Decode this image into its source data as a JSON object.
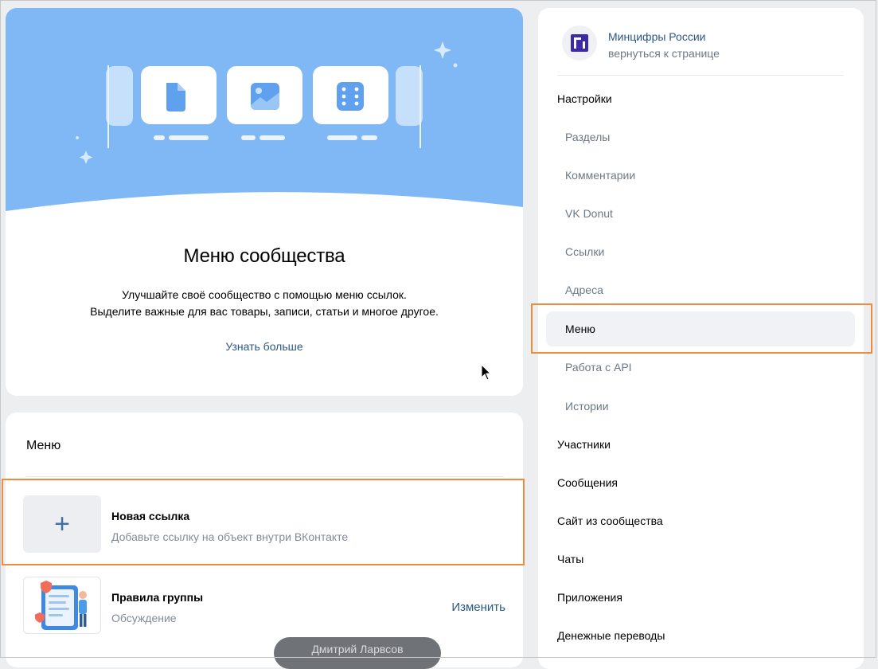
{
  "promo": {
    "title": "Меню сообщества",
    "desc_line1": "Улучшайте своё сообщество с помощью меню ссылок.",
    "desc_line2": "Выделите важные для вас товары, записи, статьи и многое другое.",
    "link": "Узнать больше",
    "hero_icons": [
      "document-icon",
      "image-icon",
      "dice-icon"
    ]
  },
  "menu": {
    "heading": "Меню",
    "items": [
      {
        "title": "Новая ссылка",
        "subtitle": "Добавьте ссылку на объект внутри ВКонтакте",
        "icon": "plus-icon"
      },
      {
        "title": "Правила группы",
        "subtitle": "Обсуждение",
        "action": "Изменить"
      }
    ]
  },
  "toast": {
    "text": "Дмитрий Ларвсов"
  },
  "community": {
    "name": "Минцифры России",
    "back": "вернуться к странице"
  },
  "settings_nav": [
    {
      "label": "Настройки",
      "kind": "section"
    },
    {
      "label": "Разделы",
      "kind": "sub"
    },
    {
      "label": "Комментарии",
      "kind": "sub"
    },
    {
      "label": "VK Donut",
      "kind": "sub"
    },
    {
      "label": "Ссылки",
      "kind": "sub"
    },
    {
      "label": "Адреса",
      "kind": "sub"
    },
    {
      "label": "Меню",
      "kind": "sub",
      "active": true
    },
    {
      "label": "Работа с API",
      "kind": "sub"
    },
    {
      "label": "Истории",
      "kind": "sub"
    },
    {
      "label": "Участники",
      "kind": "section"
    },
    {
      "label": "Сообщения",
      "kind": "section"
    },
    {
      "label": "Сайт из сообщества",
      "kind": "section"
    },
    {
      "label": "Чаты",
      "kind": "section"
    },
    {
      "label": "Приложения",
      "kind": "section"
    },
    {
      "label": "Денежные переводы",
      "kind": "section"
    }
  ],
  "colors": {
    "accent": "#2a5885",
    "hero": "#7fb8f5",
    "highlight": "#f08a3c"
  }
}
